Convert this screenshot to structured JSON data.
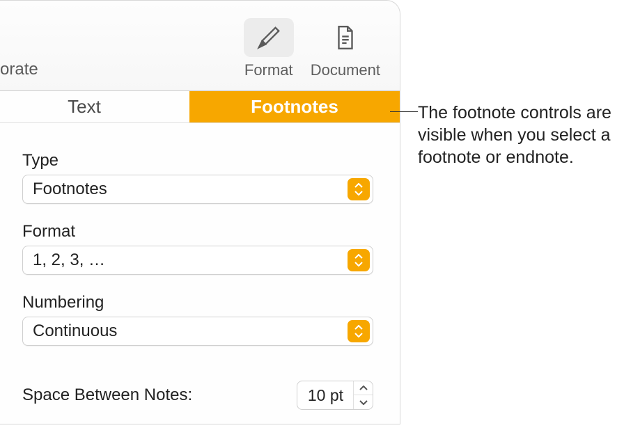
{
  "toolbar": {
    "left_text": "orate",
    "buttons": [
      {
        "label": "Format",
        "active": true
      },
      {
        "label": "Document",
        "active": false
      }
    ]
  },
  "tabs": [
    {
      "label": "Text",
      "active": false
    },
    {
      "label": "Footnotes",
      "active": true
    }
  ],
  "fields": {
    "type": {
      "label": "Type",
      "value": "Footnotes"
    },
    "format": {
      "label": "Format",
      "value": "1, 2, 3, …"
    },
    "numbering": {
      "label": "Numbering",
      "value": "Continuous"
    },
    "space": {
      "label": "Space Between Notes:",
      "value": "10 pt"
    }
  },
  "callout": "The footnote controls are visible when you select a footnote or endnote."
}
